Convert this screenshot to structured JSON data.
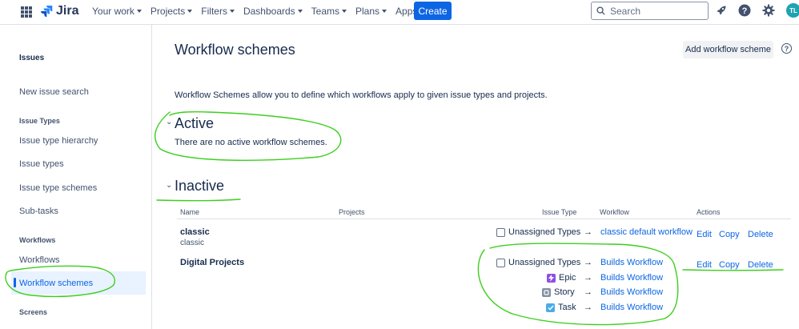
{
  "topnav": {
    "logo": "Jira",
    "items": [
      "Your work",
      "Projects",
      "Filters",
      "Dashboards",
      "Teams",
      "Plans",
      "Apps"
    ],
    "create_label": "Create",
    "search_placeholder": "Search",
    "avatar_initials": "TL"
  },
  "sidebar": {
    "title": "Issues",
    "new_issue_search": "New issue search",
    "issue_types_head": "Issue Types",
    "issue_type_hierarchy": "Issue type hierarchy",
    "issue_types": "Issue types",
    "issue_type_schemes": "Issue type schemes",
    "sub_tasks": "Sub-tasks",
    "workflows_head": "Workflows",
    "workflows": "Workflows",
    "workflow_schemes": "Workflow schemes",
    "screens_head": "Screens"
  },
  "main": {
    "title": "Workflow schemes",
    "add_button": "Add workflow scheme",
    "help": "?",
    "description": "Workflow Schemes allow you to define which workflows apply to given issue types and projects.",
    "active_title": "Active",
    "no_active": "There are no active workflow schemes.",
    "inactive_title": "Inactive",
    "columns": {
      "name": "Name",
      "projects": "Projects",
      "issue_type": "Issue Type",
      "workflow": "Workflow",
      "actions": "Actions"
    },
    "arrow": "→",
    "actions": {
      "edit": "Edit",
      "copy": "Copy",
      "delete": "Delete"
    },
    "schemes": [
      {
        "name": "classic",
        "description": "classic",
        "mappings": [
          {
            "issue_type": "Unassigned Types",
            "workflow": "classic default workflow"
          }
        ]
      },
      {
        "name": "Digital Projects",
        "mappings": [
          {
            "issue_type": "Unassigned Types",
            "workflow": "Builds Workflow"
          },
          {
            "issue_type": "Epic",
            "workflow": "Builds Workflow"
          },
          {
            "issue_type": "Story",
            "workflow": "Builds Workflow"
          },
          {
            "issue_type": "Task",
            "workflow": "Builds Workflow"
          }
        ]
      }
    ]
  },
  "colors": {
    "accent": "#0c66e4",
    "epic": "#904ee2",
    "story": "#8590a2",
    "task": "#4bade8",
    "annotation": "#3ccf1e"
  }
}
